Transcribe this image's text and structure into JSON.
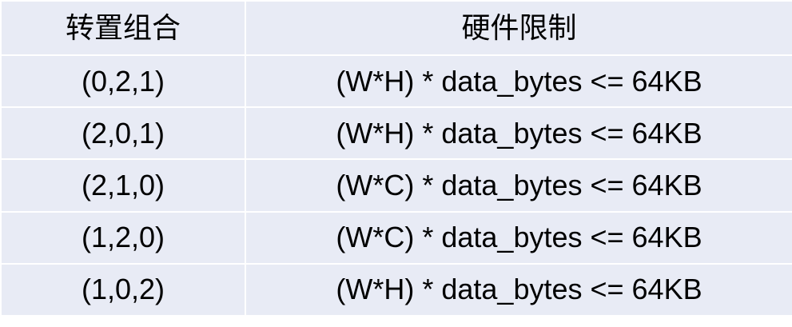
{
  "table": {
    "headers": [
      "转置组合",
      "硬件限制"
    ],
    "rows": [
      [
        "(0,2,1)",
        "(W*H) * data_bytes <= 64KB"
      ],
      [
        "(2,0,1)",
        "(W*H) * data_bytes <= 64KB"
      ],
      [
        "(2,1,0)",
        "(W*C) * data_bytes <= 64KB"
      ],
      [
        "(1,2,0)",
        "(W*C) * data_bytes <= 64KB"
      ],
      [
        "(1,0,2)",
        "(W*H) * data_bytes <= 64KB"
      ]
    ]
  },
  "colors": {
    "cell_background": "#e8ebf5",
    "grid_line": "#ffffff",
    "text": "#000000"
  }
}
